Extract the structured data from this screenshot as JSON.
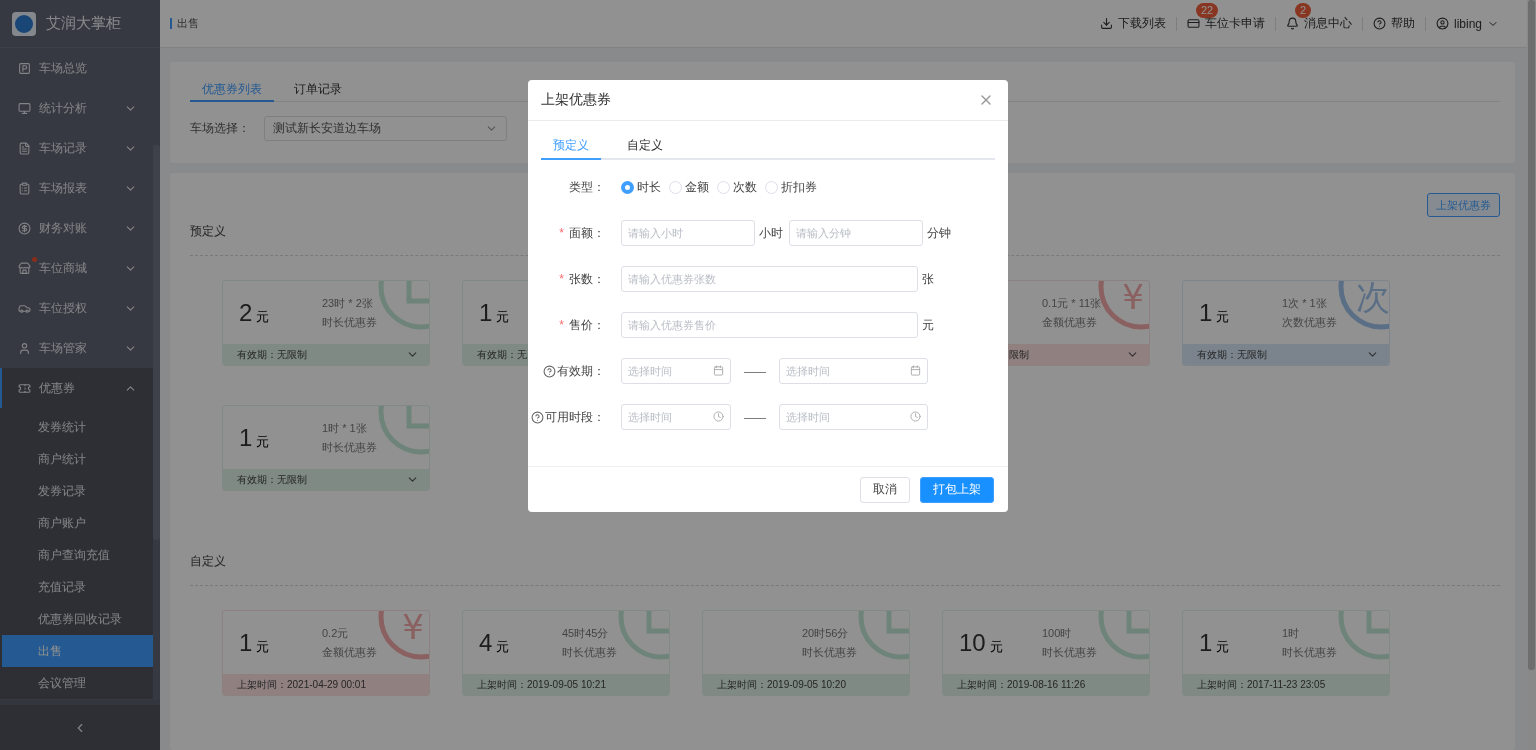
{
  "sidebar": {
    "brand": "艾润大掌柜",
    "items": [
      {
        "label": "车场总览",
        "kind": "link",
        "dot": false
      },
      {
        "label": "统计分析",
        "kind": "group",
        "expanded": false,
        "dot": false
      },
      {
        "label": "车场记录",
        "kind": "group",
        "expanded": false,
        "dot": false
      },
      {
        "label": "车场报表",
        "kind": "group",
        "expanded": false,
        "dot": false
      },
      {
        "label": "财务对账",
        "kind": "group",
        "expanded": false,
        "dot": false
      },
      {
        "label": "车位商城",
        "kind": "group",
        "expanded": false,
        "dot": true
      },
      {
        "label": "车位授权",
        "kind": "group",
        "expanded": false,
        "dot": false
      },
      {
        "label": "车场管家",
        "kind": "group",
        "expanded": false,
        "dot": false
      },
      {
        "label": "优惠券",
        "kind": "group",
        "expanded": true,
        "dot": false,
        "children": [
          {
            "label": "发券统计",
            "selected": false
          },
          {
            "label": "商户统计",
            "selected": false
          },
          {
            "label": "发券记录",
            "selected": false
          },
          {
            "label": "商户账户",
            "selected": false
          },
          {
            "label": "商户查询充值",
            "selected": false
          },
          {
            "label": "充值记录",
            "selected": false
          },
          {
            "label": "优惠券回收记录",
            "selected": false
          },
          {
            "label": "出售",
            "selected": true
          },
          {
            "label": "会议管理",
            "selected": false
          }
        ]
      }
    ]
  },
  "header": {
    "breadcrumb": "出售",
    "actions": [
      {
        "kind": "download",
        "label": "下载列表"
      },
      {
        "kind": "card",
        "label": "车位卡申请",
        "badge": "22"
      },
      {
        "kind": "bell",
        "label": "消息中心",
        "badge": "2"
      },
      {
        "kind": "help",
        "label": "帮助"
      },
      {
        "kind": "user",
        "label": "libing"
      }
    ]
  },
  "filter": {
    "tabs": [
      {
        "label": "优惠券列表",
        "selected": true
      },
      {
        "label": "订单记录",
        "selected": false
      }
    ],
    "select_label": "车场选择：",
    "select_value": "测试新长安道边车场"
  },
  "list": {
    "button": "上架优惠券",
    "sections": [
      {
        "title": "预定义",
        "rows": [
          [
            {
              "kind": "duration",
              "price": "2",
              "unit": "元",
              "line1": "23时 * 2张",
              "line2": "时长优惠券",
              "footer": "有效期：无限制",
              "collapsible": true
            },
            {
              "kind": "duration",
              "price": "1",
              "unit": "元",
              "footer": "有效期：无"
            },
            {
              "kind": "covered"
            },
            {
              "kind": "amount",
              "mark": "¥",
              "line1": "0.1元 * 11张",
              "line2": "金额优惠券",
              "footer": "限制",
              "collapsible": true,
              "clipped": true
            },
            {
              "kind": "count",
              "mark": "次",
              "price": "1",
              "unit": "元",
              "line1": "1次 * 1张",
              "line2": "次数优惠券",
              "footer": "有效期：无限制",
              "collapsible": true
            }
          ],
          [
            {
              "kind": "duration",
              "price": "1",
              "unit": "元",
              "line1": "1时 * 1张",
              "line2": "时长优惠券",
              "footer": "有效期：无限制",
              "collapsible": true
            }
          ]
        ]
      },
      {
        "title": "自定义",
        "rows": [
          [
            {
              "kind": "amount",
              "mark": "¥",
              "price": "1",
              "unit": "元",
              "line1": "0.2元",
              "line2": "金额优惠券",
              "footer": "上架时间：2021-04-29 00:01",
              "collapsible": false
            },
            {
              "kind": "duration",
              "price": "4",
              "unit": "元",
              "line1": "45时45分",
              "line2": "时长优惠券",
              "footer": "上架时间：2019-09-05 10:21",
              "collapsible": false
            },
            {
              "kind": "duration",
              "line1": "20时56分",
              "line2": "时长优惠券",
              "footer": "上架时间：2019-09-05 10:20",
              "collapsible": false
            },
            {
              "kind": "duration",
              "price": "10",
              "unit": "元",
              "line1": "100时",
              "line2": "时长优惠券",
              "footer": "上架时间：2019-08-16 11:26",
              "collapsible": false
            },
            {
              "kind": "duration",
              "price": "1",
              "unit": "元",
              "line1": "1时",
              "line2": "时长优惠券",
              "footer": "上架时间：2017-11-23 23:05",
              "collapsible": false
            }
          ]
        ]
      }
    ]
  },
  "dialog": {
    "title": "上架优惠券",
    "tabs": [
      {
        "label": "预定义",
        "selected": true
      },
      {
        "label": "自定义",
        "selected": false
      }
    ],
    "form": [
      {
        "kind": "radio",
        "label": "类型：",
        "options": [
          {
            "label": "时长",
            "selected": true
          },
          {
            "label": "金额",
            "selected": false
          },
          {
            "label": "次数",
            "selected": false
          },
          {
            "label": "折扣券",
            "selected": false
          }
        ]
      },
      {
        "kind": "pair",
        "label": "面额：",
        "required_mark": "*",
        "inputs": [
          {
            "placeholder": "请输入小时",
            "suffix": "小时"
          },
          {
            "placeholder": "请输入分钟",
            "suffix": "分钟"
          }
        ]
      },
      {
        "kind": "single",
        "label": "张数：",
        "required_mark": "*",
        "placeholder": "请输入优惠券张数",
        "suffix": "张"
      },
      {
        "kind": "single",
        "label": "售价：",
        "required_mark": "*",
        "placeholder": "请输入优惠券售价",
        "suffix": "元"
      },
      {
        "kind": "date_range",
        "label": "有效期：",
        "help": true,
        "fields": [
          {
            "placeholder": "选择时间"
          },
          {
            "placeholder": "选择时间"
          }
        ],
        "separator": "——"
      },
      {
        "kind": "time_range",
        "label": "可用时段：",
        "help": true,
        "fields": [
          {
            "placeholder": "选择时间"
          },
          {
            "placeholder": "选择时间"
          }
        ],
        "separator": "——"
      }
    ],
    "buttons": [
      {
        "kind": "default",
        "label": "取消"
      },
      {
        "kind": "primary",
        "label": "打包上架"
      }
    ]
  }
}
